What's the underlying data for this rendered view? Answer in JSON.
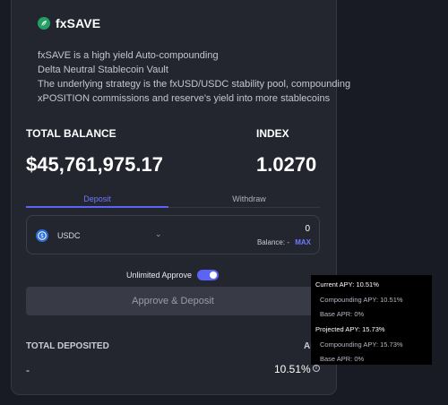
{
  "brand": {
    "name": "fxSAVE"
  },
  "description": [
    "fxSAVE is a high yield Auto-compounding",
    "Delta Neutral Stablecoin Vault",
    "The underlying strategy is the fxUSD/USDC stability pool, compounding",
    "xPOSITION commissions and reserve's yield into more stablecoins"
  ],
  "stats": {
    "total_balance_label": "TOTAL BALANCE",
    "total_balance_value": "$45,761,975.17",
    "index_label": "INDEX",
    "index_value": "1.0270"
  },
  "tabs": {
    "deposit": "Deposit",
    "withdraw": "Withdraw"
  },
  "asset": {
    "name": "USDC",
    "amount": "0",
    "balance": "Balance: -",
    "max": "MAX"
  },
  "approve": {
    "toggle_label": "Unlimited Approve",
    "toggle_on": true,
    "button_label": "Approve & Deposit"
  },
  "deposited": {
    "label": "TOTAL DEPOSITED",
    "apr_label": "AP",
    "value": "-",
    "apy_value": "10.51%"
  },
  "tooltip": {
    "current": "Current APY: 10.51%",
    "current_compounding": "Compounding APY: 10.51%",
    "current_base": "Base APR: 0%",
    "projected": "Projected APY: 15.73%",
    "projected_compounding": "Compounding APY: 15.73%",
    "projected_base": "Base APR: 0%"
  },
  "colors": {
    "accent": "#5b64f6",
    "background": "#191b24",
    "card": "#23252f",
    "brand": "#22a064"
  }
}
